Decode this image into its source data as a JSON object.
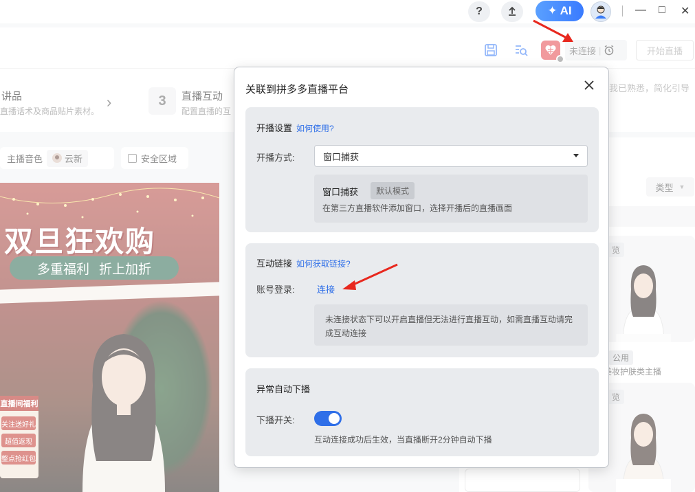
{
  "titlebar": {
    "help_icon": "?",
    "upload_icon": "upload-icon",
    "ai_label": "AI",
    "minimize": "—",
    "maximize": "□",
    "close": "✕"
  },
  "toolbar": {
    "status_text": "未连接",
    "start_label": "开始直播"
  },
  "steps": {
    "step2_title": "讲品",
    "step2_sub": "直播话术及商品贴片素材。",
    "step3_num": "3",
    "step3_title": "直播互动",
    "step3_sub": "配置直播的互",
    "hint": "我已熟悉，简化引导"
  },
  "left": {
    "voice_label": "主播音色",
    "voice_name": "云新",
    "safe_area_label": "安全区域"
  },
  "poster": {
    "title": "双旦狂欢购",
    "banner_left": "多重福利",
    "banner_right": "折上加折",
    "side_badge": "直播间福利",
    "side_items": [
      "关注送好礼",
      "超值返现",
      "整点抢红包"
    ]
  },
  "right": {
    "type_label": "类型",
    "card1_tag": "览",
    "public_tag": "公用",
    "card_label": "美妆护肤类主播",
    "card2_tag": "览"
  },
  "dialog": {
    "title": "关联到拼多多直播平台",
    "section1": {
      "title": "开播设置",
      "link": "如何使用?",
      "mode_label": "开播方式:",
      "mode_value": "窗口捕获",
      "info_name": "窗口捕获",
      "info_badge": "默认模式",
      "info_desc": "在第三方直播软件添加窗口，选择开播后的直播画面"
    },
    "section2": {
      "title": "互动链接",
      "link": "如何获取链接?",
      "account_label": "账号登录:",
      "connect_label": "连接",
      "warning": "未连接状态下可以开启直播但无法进行直播互动，如需直播互动请完成互动连接"
    },
    "section3": {
      "title": "异常自动下播",
      "switch_label": "下播开关:",
      "switch_on": true,
      "switch_desc": "互动连接成功后生效，当直播断开2分钟自动下播"
    }
  },
  "colors": {
    "accent": "#2f6fe8",
    "annotation_arrow": "#e8281e",
    "brand_red": "#e5484d"
  }
}
